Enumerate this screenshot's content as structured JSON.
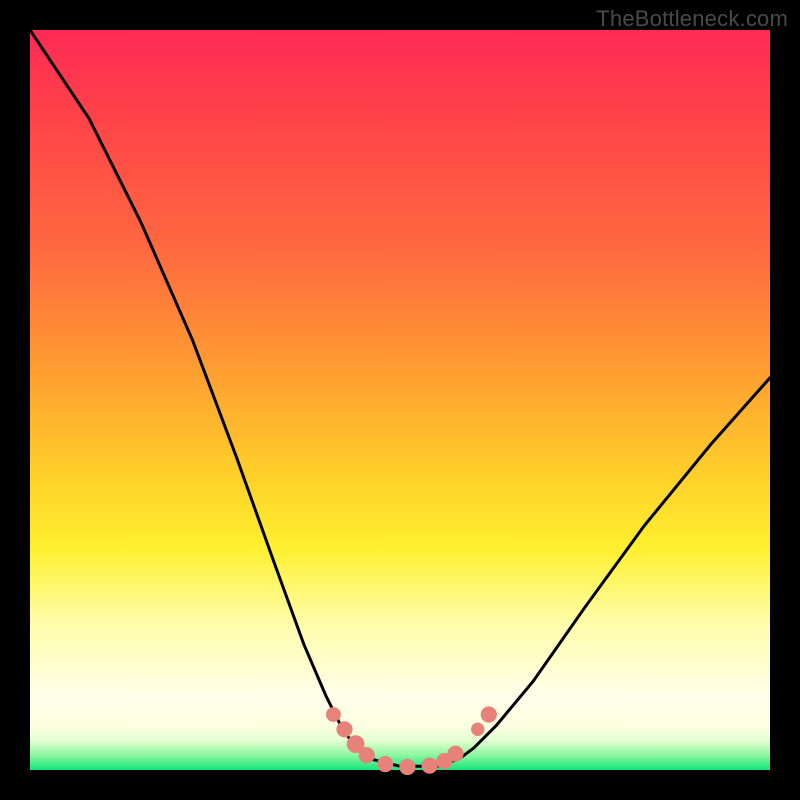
{
  "watermark": "TheBottleneck.com",
  "colors": {
    "frame": "#000000",
    "gradient_top": "#ff2a55",
    "gradient_mid": "#ffcf2a",
    "gradient_bottom": "#14e67a",
    "curve": "#000000",
    "marker": "#e6827a"
  },
  "chart_data": {
    "type": "line",
    "title": "",
    "xlabel": "",
    "ylabel": "",
    "xlim": [
      0,
      1
    ],
    "ylim": [
      0,
      1
    ],
    "annotations": [
      "TheBottleneck.com"
    ],
    "series": [
      {
        "name": "bottleneck-curve",
        "x": [
          0.0,
          0.08,
          0.15,
          0.22,
          0.28,
          0.33,
          0.37,
          0.4,
          0.42,
          0.44,
          0.46,
          0.5,
          0.55,
          0.58,
          0.6,
          0.63,
          0.68,
          0.75,
          0.83,
          0.92,
          1.0
        ],
        "y": [
          1.0,
          0.88,
          0.74,
          0.58,
          0.42,
          0.28,
          0.17,
          0.1,
          0.06,
          0.03,
          0.015,
          0.005,
          0.005,
          0.015,
          0.03,
          0.06,
          0.12,
          0.22,
          0.33,
          0.44,
          0.53
        ]
      }
    ],
    "markers": [
      {
        "x": 0.41,
        "y": 0.075,
        "r": 0.01
      },
      {
        "x": 0.425,
        "y": 0.055,
        "r": 0.011
      },
      {
        "x": 0.44,
        "y": 0.035,
        "r": 0.012
      },
      {
        "x": 0.455,
        "y": 0.02,
        "r": 0.011
      },
      {
        "x": 0.48,
        "y": 0.008,
        "r": 0.011
      },
      {
        "x": 0.51,
        "y": 0.004,
        "r": 0.011
      },
      {
        "x": 0.54,
        "y": 0.006,
        "r": 0.011
      },
      {
        "x": 0.56,
        "y": 0.012,
        "r": 0.011
      },
      {
        "x": 0.575,
        "y": 0.022,
        "r": 0.011
      },
      {
        "x": 0.605,
        "y": 0.055,
        "r": 0.009
      },
      {
        "x": 0.62,
        "y": 0.075,
        "r": 0.011
      }
    ]
  }
}
